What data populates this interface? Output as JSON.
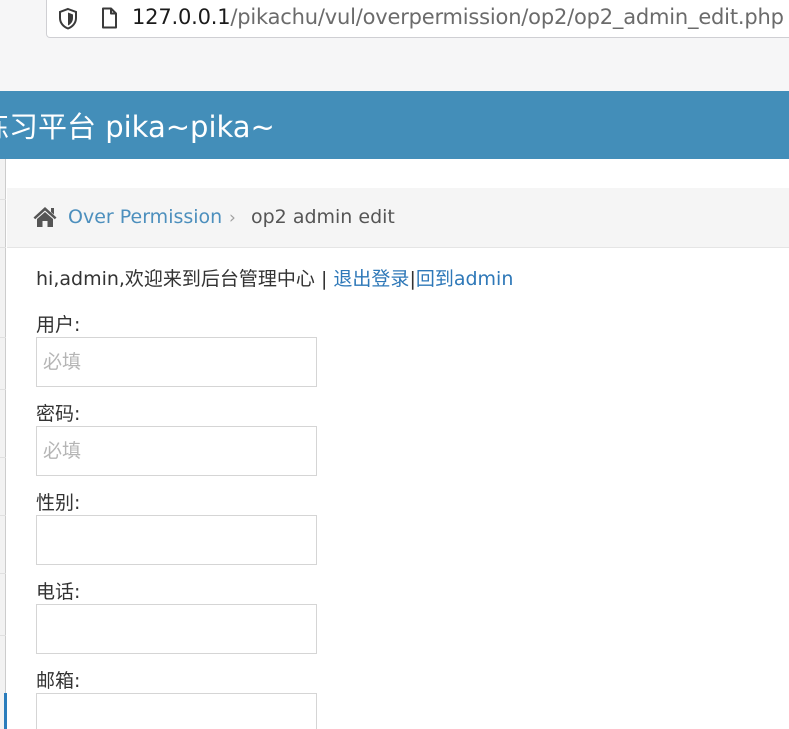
{
  "browser": {
    "url_host": "127.0.0.1",
    "url_path": "/pikachu/vul/overpermission/op2/op2_admin_edit.php",
    "icons": [
      "shield-icon",
      "page-icon"
    ]
  },
  "header": {
    "title": "练习平台 pika~pika~"
  },
  "breadcrumb": {
    "home_icon": "home-icon",
    "parent": "Over Permission",
    "separator": "›",
    "current": "op2 admin edit"
  },
  "welcome": {
    "text": "hi,admin,欢迎来到后台管理中心 | ",
    "logout": "退出登录",
    "divider": "|",
    "back": "回到admin"
  },
  "form": {
    "fields": [
      {
        "label": "用户:",
        "placeholder": "必填",
        "value": ""
      },
      {
        "label": "密码:",
        "placeholder": "必填",
        "value": ""
      },
      {
        "label": "性别:",
        "placeholder": "",
        "value": ""
      },
      {
        "label": "电话:",
        "placeholder": "",
        "value": ""
      },
      {
        "label": "邮箱:",
        "placeholder": "",
        "value": ""
      }
    ]
  },
  "colors": {
    "header_bg": "#438eb9",
    "link": "#2e78b8",
    "breadcrumb_bg": "#f5f5f5"
  }
}
